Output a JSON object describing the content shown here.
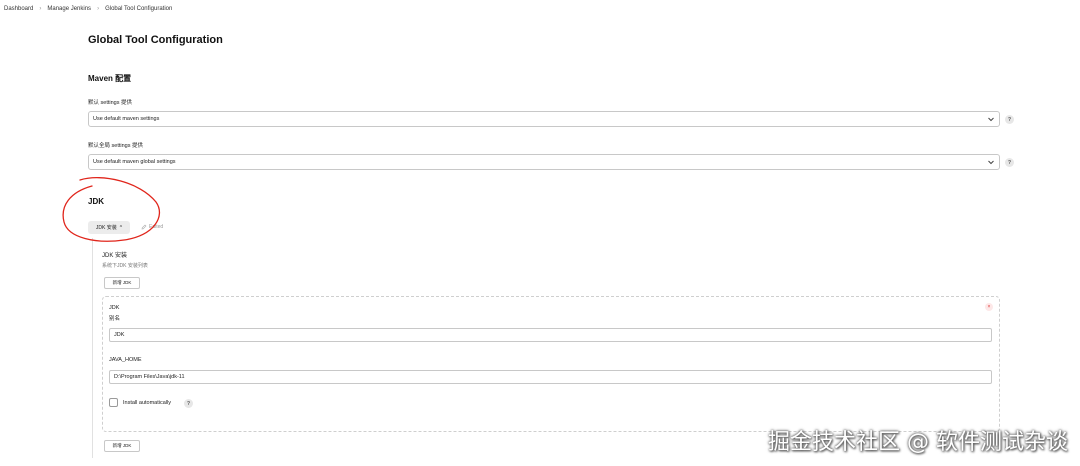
{
  "breadcrumb": [
    {
      "label": "Dashboard"
    },
    {
      "label": "Manage Jenkins"
    },
    {
      "label": "Global Tool Configuration"
    }
  ],
  "page_title": "Global Tool Configuration",
  "maven": {
    "section_title": "Maven 配置",
    "settings_label": "默认 settings 提供",
    "settings_value": "Use default maven settings",
    "global_settings_label": "默认全局 settings 提供",
    "global_settings_value": "Use default maven global settings",
    "help_glyph": "?"
  },
  "jdk": {
    "section_title": "JDK",
    "toggle_label": "JDK 安装",
    "toggle_chevron": "^",
    "edited_label": "Edited",
    "install_title": "JDK 安装",
    "install_desc": "系统下JDK 安装列表",
    "add_button_label": "新增 JDK",
    "entry": {
      "heading": "JDK",
      "name_label": "别名",
      "name_value": "JDK",
      "home_label": "JAVA_HOME",
      "home_value": "D:\\Program Files\\Java\\jdk-11",
      "install_auto_label": "Install automatically",
      "install_auto_checked": false,
      "close_glyph": "×"
    },
    "add_button_bottom_label": "新增 JDK"
  },
  "watermark": "掘金技术社区 @ 软件测试杂谈",
  "colors": {
    "annotation": "#e0251b",
    "close": "#d33333"
  }
}
